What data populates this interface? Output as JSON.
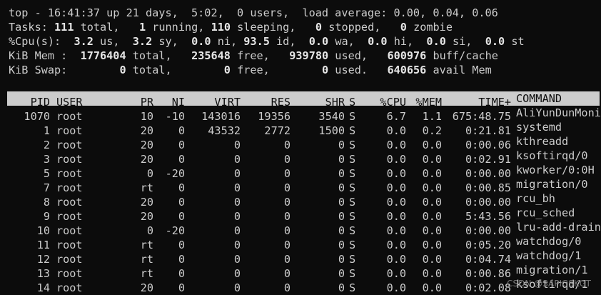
{
  "summary": {
    "uptime": {
      "prefix": "top - 16:41:37 up 21 days,  5:02,  0 users,  load average: 0.00, 0.04, 0.06"
    },
    "tasks": {
      "label": "Tasks:",
      "total": "111",
      "total_label": "total,",
      "running": "1",
      "running_label": "running,",
      "sleeping": "110",
      "sleeping_label": "sleeping,",
      "stopped": "0",
      "stopped_label": "stopped,",
      "zombie": "0",
      "zombie_label": "zombie"
    },
    "cpu": {
      "label": "%Cpu(s):",
      "us": "3.2",
      "us_label": "us,",
      "sy": "3.2",
      "sy_label": "sy,",
      "ni": "0.0",
      "ni_label": "ni,",
      "id": "93.5",
      "id_label": "id,",
      "wa": "0.0",
      "wa_label": "wa,",
      "hi": "0.0",
      "hi_label": "hi,",
      "si": "0.0",
      "si_label": "si,",
      "st": "0.0",
      "st_label": "st"
    },
    "mem": {
      "label": "KiB Mem :",
      "total": "1776404",
      "total_label": "total,",
      "free": "235648",
      "free_label": "free,",
      "used": "939780",
      "used_label": "used,",
      "buff": "600976",
      "buff_label": "buff/cache"
    },
    "swap": {
      "label": "KiB Swap:",
      "total": "0",
      "total_label": "total,",
      "free": "0",
      "free_label": "free,",
      "used": "0",
      "used_label": "used.",
      "avail": "640656",
      "avail_label": "avail Mem"
    }
  },
  "table": {
    "columns": {
      "pid": "PID",
      "user": "USER",
      "pr": "PR",
      "ni": "NI",
      "virt": "VIRT",
      "res": "RES",
      "shr": "SHR",
      "s": "S",
      "cpu": "%CPU",
      "mem": "%MEM",
      "time": "TIME+",
      "command": "COMMAND"
    },
    "rows": [
      {
        "pid": "1070",
        "user": "root",
        "pr": "10",
        "ni": "-10",
        "virt": "143016",
        "res": "19356",
        "shr": "3540",
        "s": "S",
        "cpu": "6.7",
        "mem": "1.1",
        "time": "675:48.75",
        "command": "AliYunDunMonito"
      },
      {
        "pid": "1",
        "user": "root",
        "pr": "20",
        "ni": "0",
        "virt": "43532",
        "res": "2772",
        "shr": "1500",
        "s": "S",
        "cpu": "0.0",
        "mem": "0.2",
        "time": "0:21.81",
        "command": "systemd"
      },
      {
        "pid": "2",
        "user": "root",
        "pr": "20",
        "ni": "0",
        "virt": "0",
        "res": "0",
        "shr": "0",
        "s": "S",
        "cpu": "0.0",
        "mem": "0.0",
        "time": "0:00.06",
        "command": "kthreadd"
      },
      {
        "pid": "3",
        "user": "root",
        "pr": "20",
        "ni": "0",
        "virt": "0",
        "res": "0",
        "shr": "0",
        "s": "S",
        "cpu": "0.0",
        "mem": "0.0",
        "time": "0:02.91",
        "command": "ksoftirqd/0"
      },
      {
        "pid": "5",
        "user": "root",
        "pr": "0",
        "ni": "-20",
        "virt": "0",
        "res": "0",
        "shr": "0",
        "s": "S",
        "cpu": "0.0",
        "mem": "0.0",
        "time": "0:00.00",
        "command": "kworker/0:0H"
      },
      {
        "pid": "7",
        "user": "root",
        "pr": "rt",
        "ni": "0",
        "virt": "0",
        "res": "0",
        "shr": "0",
        "s": "S",
        "cpu": "0.0",
        "mem": "0.0",
        "time": "0:00.85",
        "command": "migration/0"
      },
      {
        "pid": "8",
        "user": "root",
        "pr": "20",
        "ni": "0",
        "virt": "0",
        "res": "0",
        "shr": "0",
        "s": "S",
        "cpu": "0.0",
        "mem": "0.0",
        "time": "0:00.00",
        "command": "rcu_bh"
      },
      {
        "pid": "9",
        "user": "root",
        "pr": "20",
        "ni": "0",
        "virt": "0",
        "res": "0",
        "shr": "0",
        "s": "S",
        "cpu": "0.0",
        "mem": "0.0",
        "time": "5:43.56",
        "command": "rcu_sched"
      },
      {
        "pid": "10",
        "user": "root",
        "pr": "0",
        "ni": "-20",
        "virt": "0",
        "res": "0",
        "shr": "0",
        "s": "S",
        "cpu": "0.0",
        "mem": "0.0",
        "time": "0:00.00",
        "command": "lru-add-drain"
      },
      {
        "pid": "11",
        "user": "root",
        "pr": "rt",
        "ni": "0",
        "virt": "0",
        "res": "0",
        "shr": "0",
        "s": "S",
        "cpu": "0.0",
        "mem": "0.0",
        "time": "0:05.20",
        "command": "watchdog/0"
      },
      {
        "pid": "12",
        "user": "root",
        "pr": "rt",
        "ni": "0",
        "virt": "0",
        "res": "0",
        "shr": "0",
        "s": "S",
        "cpu": "0.0",
        "mem": "0.0",
        "time": "0:04.74",
        "command": "watchdog/1"
      },
      {
        "pid": "13",
        "user": "root",
        "pr": "rt",
        "ni": "0",
        "virt": "0",
        "res": "0",
        "shr": "0",
        "s": "S",
        "cpu": "0.0",
        "mem": "0.0",
        "time": "0:00.86",
        "command": "migration/1"
      },
      {
        "pid": "14",
        "user": "root",
        "pr": "20",
        "ni": "0",
        "virt": "0",
        "res": "0",
        "shr": "0",
        "s": "S",
        "cpu": "0.0",
        "mem": "0.0",
        "time": "0:02.08",
        "command": "ksoftirqd/1"
      }
    ]
  },
  "watermark": "CSDN @SAPIGSKGT",
  "colors": {
    "background": "#0c0c0c",
    "foreground": "#cccccc",
    "header_bg": "#cccccc"
  }
}
